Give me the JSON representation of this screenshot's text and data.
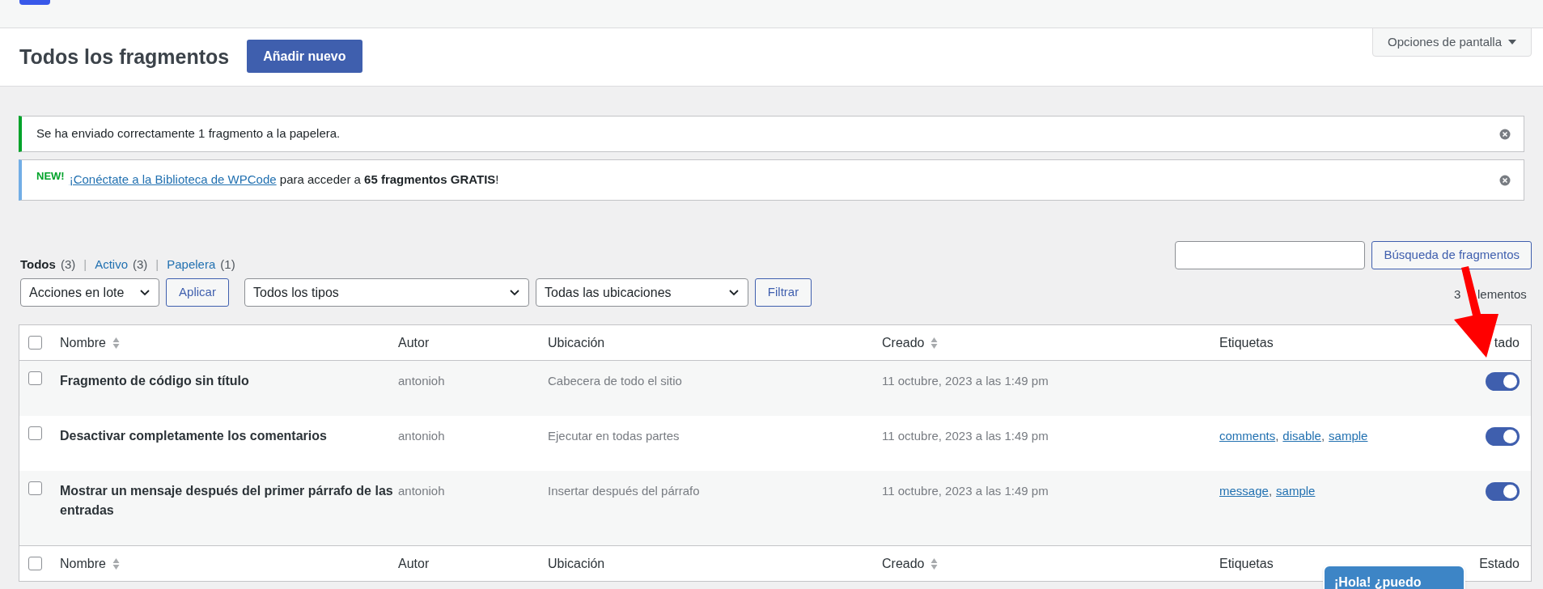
{
  "screen_options": "Opciones de pantalla",
  "header": {
    "title": "Todos los fragmentos",
    "add_button": "Añadir nuevo"
  },
  "notices": [
    {
      "kind": "success",
      "text": "Se ha enviado correctamente 1 fragmento a la papelera."
    },
    {
      "kind": "info",
      "badge": "NEW!",
      "link": "¡Conéctate a la Biblioteca de WPCode",
      "text": "para acceder a **65 fragmentos GRATIS**!"
    }
  ],
  "views": [
    {
      "label": "Todos",
      "count": "(3)",
      "selected": true
    },
    {
      "separator": "|",
      "label": "Activo",
      "count": "(3)",
      "selected": false
    },
    {
      "separator": "|",
      "label": "Papelera",
      "count": "(1)",
      "selected": false
    }
  ],
  "search_button": "Búsqueda de fragmentos",
  "filters": {
    "bulk_action": "Acciones en lote",
    "apply": "Aplicar",
    "type": "Todos los tipos",
    "location": "Todas las ubicaciones",
    "filter": "Filtrar"
  },
  "item_count": {
    "visible_start": "3",
    "visible_end": "lementos"
  },
  "table": {
    "select_all_checked": false,
    "footer_select_all_checked": false,
    "columns": [
      {
        "label": "Nombre",
        "sortable": true
      },
      {
        "label": "Autor",
        "sortable": false
      },
      {
        "label": "Ubicación",
        "sortable": false
      },
      {
        "label": "Creado",
        "sortable": true
      },
      {
        "label": "Etiquetas",
        "sortable": false
      },
      {
        "label": "tado",
        "sortable": false
      }
    ],
    "footer_columns": [
      {
        "label": "Nombre",
        "sortable": true
      },
      {
        "label": "Autor",
        "sortable": false
      },
      {
        "label": "Ubicación",
        "sortable": false
      },
      {
        "label": "Creado",
        "sortable": true
      },
      {
        "label": "Etiquetas",
        "sortable": false
      },
      {
        "label": "Estado",
        "sortable": false
      }
    ],
    "rows": [
      {
        "name": "Fragmento de código sin título",
        "author": "antonioh",
        "location": "Cabecera de todo el sitio",
        "created": "11 octubre, 2023 a las 1:49 pm",
        "tags": [],
        "checked": false,
        "active": true
      },
      {
        "name": "Desactivar completamente los comentarios",
        "author": "antonioh",
        "location": "Ejecutar en todas partes",
        "created": "11 octubre, 2023 a las 1:49 pm",
        "tags": [
          {
            "label": "comments",
            "separator": ","
          },
          {
            "label": "disable",
            "separator": ","
          },
          {
            "label": "sample"
          }
        ],
        "checked": false,
        "active": true
      },
      {
        "name": "Mostrar un mensaje después del primer párrafo de las entradas",
        "author": "antonioh",
        "location": "Insertar después del párrafo",
        "created": "11 octubre, 2023 a las 1:49 pm",
        "tags": [
          {
            "label": "message",
            "separator": ","
          },
          {
            "label": "sample"
          }
        ],
        "checked": false,
        "active": true
      }
    ]
  },
  "chat_bubble": "¡Hola! ¿puedo"
}
